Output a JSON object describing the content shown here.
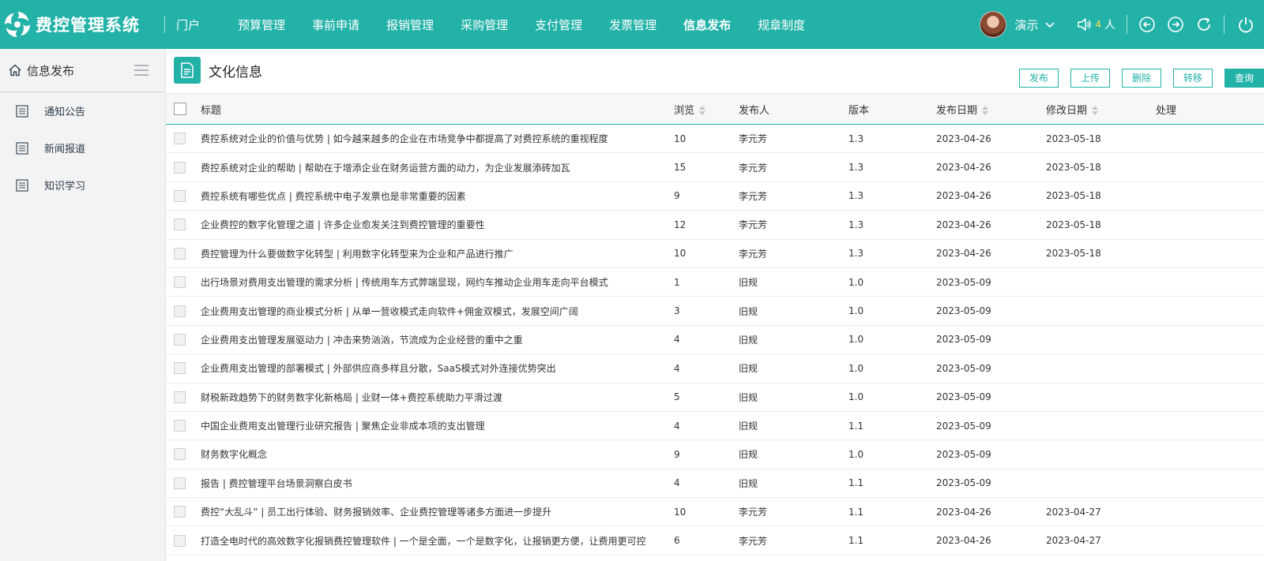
{
  "app": {
    "title": "费控管理系统"
  },
  "nav": {
    "items": [
      {
        "label": "门户",
        "active": false
      },
      {
        "label": "预算管理",
        "active": false
      },
      {
        "label": "事前申请",
        "active": false
      },
      {
        "label": "报销管理",
        "active": false
      },
      {
        "label": "采购管理",
        "active": false
      },
      {
        "label": "支付管理",
        "active": false
      },
      {
        "label": "发票管理",
        "active": false
      },
      {
        "label": "信息发布",
        "active": true
      },
      {
        "label": "规章制度",
        "active": false
      }
    ]
  },
  "user": {
    "name": "演示",
    "online_count": "4",
    "online_unit": "人"
  },
  "sidebar": {
    "title": "信息发布",
    "items": [
      {
        "label": "通知公告"
      },
      {
        "label": "新闻报道"
      },
      {
        "label": "知识学习"
      }
    ]
  },
  "page": {
    "title": "文化信息",
    "actions": [
      {
        "label": "发布",
        "primary": false
      },
      {
        "label": "上传",
        "primary": false
      },
      {
        "label": "删除",
        "primary": false
      },
      {
        "label": "转移",
        "primary": false
      },
      {
        "label": "查询",
        "primary": true
      }
    ]
  },
  "table": {
    "columns": [
      {
        "label": "标题",
        "sortable": false
      },
      {
        "label": "浏览",
        "sortable": true
      },
      {
        "label": "发布人",
        "sortable": false
      },
      {
        "label": "版本",
        "sortable": false
      },
      {
        "label": "发布日期",
        "sortable": true
      },
      {
        "label": "修改日期",
        "sortable": true
      },
      {
        "label": "处理",
        "sortable": false
      }
    ],
    "rows": [
      {
        "title": "费控系统对企业的价值与优势 | 如今越来越多的企业在市场竞争中都提高了对费控系统的重视程度",
        "views": "10",
        "publisher": "李元芳",
        "version": "1.3",
        "publish_date": "2023-04-26",
        "modified_date": "2023-05-18"
      },
      {
        "title": "费控系统对企业的帮助 | 帮助在于增添企业在财务运营方面的动力，为企业发展添砖加瓦",
        "views": "15",
        "publisher": "李元芳",
        "version": "1.3",
        "publish_date": "2023-04-26",
        "modified_date": "2023-05-18"
      },
      {
        "title": "费控系统有哪些优点 | 费控系统中电子发票也是非常重要的因素",
        "views": "9",
        "publisher": "李元芳",
        "version": "1.3",
        "publish_date": "2023-04-26",
        "modified_date": "2023-05-18"
      },
      {
        "title": "企业费控的数字化管理之道 | 许多企业愈发关注到费控管理的重要性",
        "views": "12",
        "publisher": "李元芳",
        "version": "1.3",
        "publish_date": "2023-04-26",
        "modified_date": "2023-05-18"
      },
      {
        "title": "费控管理为什么要做数字化转型 | 利用数字化转型来为企业和产品进行推广",
        "views": "10",
        "publisher": "李元芳",
        "version": "1.3",
        "publish_date": "2023-04-26",
        "modified_date": "2023-05-18"
      },
      {
        "title": "出行场景对费用支出管理的需求分析 | 传统用车方式弊端显现，网约车推动企业用车走向平台模式",
        "views": "1",
        "publisher": "旧规",
        "version": "1.0",
        "publish_date": "2023-05-09",
        "modified_date": ""
      },
      {
        "title": "企业费用支出管理的商业模式分析 | 从单一营收模式走向软件+佣金双模式，发展空间广阔",
        "views": "3",
        "publisher": "旧规",
        "version": "1.0",
        "publish_date": "2023-05-09",
        "modified_date": ""
      },
      {
        "title": "企业费用支出管理发展驱动力 | 冲击来势汹汹，节流成为企业经营的重中之重",
        "views": "4",
        "publisher": "旧规",
        "version": "1.0",
        "publish_date": "2023-05-09",
        "modified_date": ""
      },
      {
        "title": "企业费用支出管理的部署模式 | 外部供应商多样且分散，SaaS模式对外连接优势突出",
        "views": "4",
        "publisher": "旧规",
        "version": "1.0",
        "publish_date": "2023-05-09",
        "modified_date": ""
      },
      {
        "title": "财税新政趋势下的财务数字化新格局 | 业财一体+费控系统助力平滑过渡",
        "views": "5",
        "publisher": "旧规",
        "version": "1.0",
        "publish_date": "2023-05-09",
        "modified_date": ""
      },
      {
        "title": "中国企业费用支出管理行业研究报告 | 聚焦企业非成本项的支出管理",
        "views": "4",
        "publisher": "旧规",
        "version": "1.1",
        "publish_date": "2023-05-09",
        "modified_date": ""
      },
      {
        "title": "财务数字化概念",
        "views": "9",
        "publisher": "旧规",
        "version": "1.0",
        "publish_date": "2023-05-09",
        "modified_date": ""
      },
      {
        "title": "报告 | 费控管理平台场景洞察白皮书",
        "views": "4",
        "publisher": "旧规",
        "version": "1.1",
        "publish_date": "2023-05-09",
        "modified_date": ""
      },
      {
        "title": "费控“大乱斗” | 员工出行体验、财务报销效率、企业费控管理等诸多方面进一步提升",
        "views": "10",
        "publisher": "李元芳",
        "version": "1.1",
        "publish_date": "2023-04-26",
        "modified_date": "2023-04-27"
      },
      {
        "title": "打造全电时代的高效数字化报销费控管理软件 | 一个是全面，一个是数字化，让报销更方便，让费用更可控",
        "views": "6",
        "publisher": "李元芳",
        "version": "1.1",
        "publish_date": "2023-04-26",
        "modified_date": "2023-04-27"
      }
    ]
  },
  "colors": {
    "brand": "#22b2a8",
    "online_count": "#ffe04a",
    "sidebar_bg": "#f3f3f3"
  }
}
